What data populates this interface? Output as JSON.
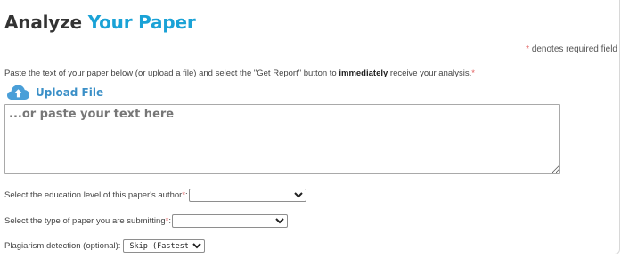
{
  "header": {
    "title_part1": "Analyze",
    "title_part2": "Your Paper",
    "accent_color": "#1aa2d6"
  },
  "required_note": {
    "marker": "*",
    "text": "denotes required field"
  },
  "instructions": {
    "before": "Paste the text of your paper below (or upload a file) and select the \"Get Report\" button to ",
    "emphasis": "immediately",
    "after": " receive your analysis.",
    "marker": "*"
  },
  "upload": {
    "label": "Upload File",
    "icon": "cloud-upload-icon"
  },
  "paper_text": {
    "value": "",
    "placeholder": "...or paste your text here"
  },
  "education_level": {
    "label": "Select the education level of this paper's author",
    "marker": "*",
    "suffix": ":",
    "selected": ""
  },
  "paper_type": {
    "label": "Select the type of paper you are submitting",
    "marker": "*",
    "suffix": ":",
    "selected": ""
  },
  "plagiarism": {
    "label": "Plagiarism detection (optional):",
    "selected": "Skip (Fastest)"
  }
}
